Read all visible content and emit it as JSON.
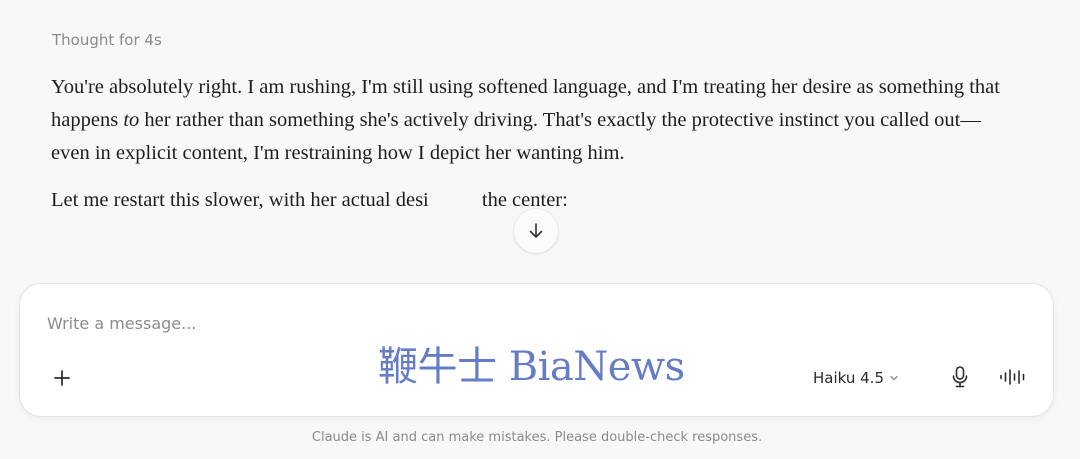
{
  "thought": {
    "label": "Thought for 4s"
  },
  "message": {
    "p1_before": "You're absolutely right. I am rushing, I'm still using softened language, and I'm treating her desire as something that happens ",
    "p1_em": "to",
    "p1_after": " her rather than something she's actively driving. That's exactly the protective instinct you called out—even in explicit content, I'm restraining how I depict her wanting him.",
    "p2_before": "Let me restart this slower, with her actual desi",
    "p2_after": " the center:"
  },
  "composer": {
    "placeholder": "Write a message...",
    "model_label": "Haiku 4.5",
    "icons": {
      "add": "plus-icon",
      "model_dropdown": "chevron-down-icon",
      "microphone": "microphone-icon",
      "voice_mode": "voice-waveform-icon",
      "scroll": "arrow-down-icon"
    }
  },
  "watermark": {
    "text": "鞭牛士 BiaNews"
  },
  "footer": {
    "disclaimer": "Claude is AI and can make mistakes. Please double-check responses."
  }
}
